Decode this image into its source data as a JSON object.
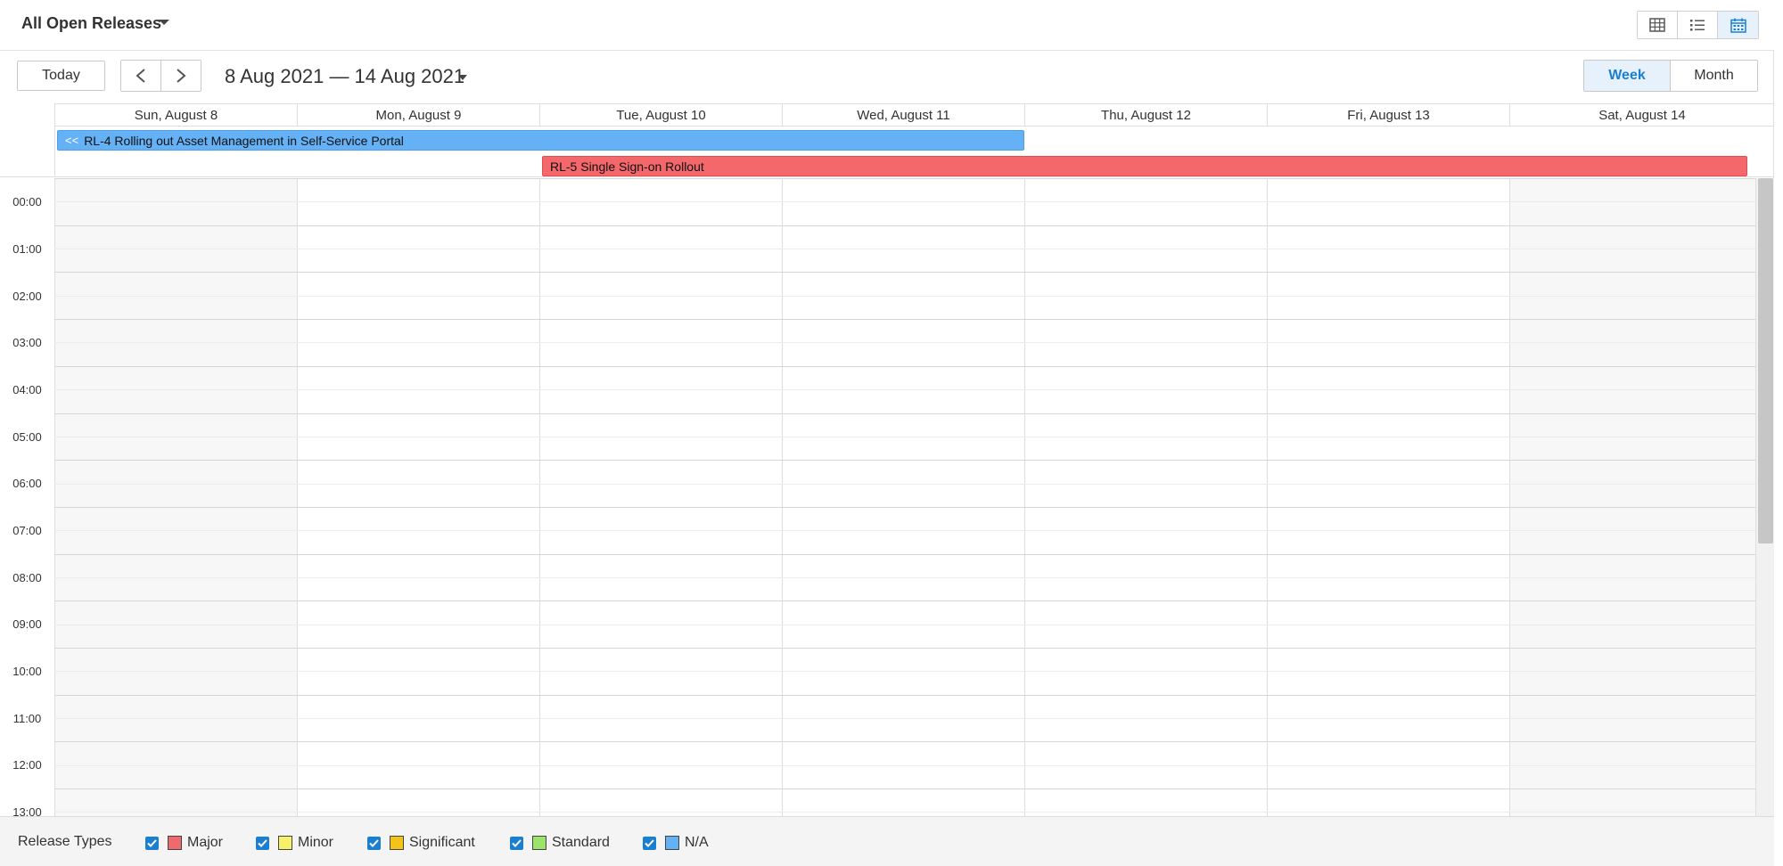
{
  "header": {
    "title": "All Open Releases",
    "view_buttons": [
      {
        "name": "grid-view",
        "icon": "grid-icon"
      },
      {
        "name": "list-view",
        "icon": "list-icon"
      },
      {
        "name": "calendar-view",
        "icon": "calendar-icon",
        "active": true
      }
    ]
  },
  "toolbar": {
    "today_label": "Today",
    "prev_label": "<",
    "next_label": ">",
    "date_range": "8 Aug 2021 — 14 Aug 2021",
    "week_label": "Week",
    "month_label": "Month",
    "active_mode": "Week"
  },
  "calendar": {
    "days": [
      "Sun, August 8",
      "Mon, August 9",
      "Tue, August 10",
      "Wed, August 11",
      "Thu, August 12",
      "Fri, August 13",
      "Sat, August 14"
    ],
    "hours": [
      "00:00",
      "01:00",
      "02:00",
      "03:00",
      "04:00",
      "05:00",
      "06:00",
      "07:00",
      "08:00",
      "09:00",
      "10:00",
      "11:00",
      "12:00",
      "13:00"
    ],
    "events": [
      {
        "label": "RL-4 Rolling out Asset Management in Self-Service Portal",
        "continues_marker": "<<",
        "color": "#64b1f5",
        "start_day": "Sun, August 8",
        "end_day": "Wed, August 11"
      },
      {
        "label": "RL-5 Single Sign-on Rollout",
        "color": "#f4676b",
        "start_day": "Tue, August 10",
        "end_day": "Sat, August 14"
      }
    ]
  },
  "legend": {
    "title": "Release Types",
    "items": [
      {
        "label": "Major",
        "color": "#ef6a6e",
        "checked": true
      },
      {
        "label": "Minor",
        "color": "#f7f06a",
        "checked": true
      },
      {
        "label": "Significant",
        "color": "#f2c318",
        "checked": true
      },
      {
        "label": "Standard",
        "color": "#9be36a",
        "checked": true
      },
      {
        "label": "N/A",
        "color": "#64b1f5",
        "checked": true
      }
    ]
  },
  "colors": {
    "accent": "#1a7fd1",
    "active_bg": "#e6f1fb"
  }
}
